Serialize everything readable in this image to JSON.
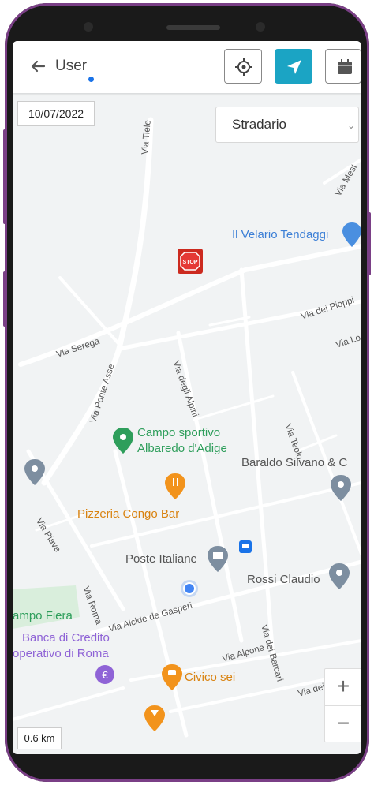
{
  "appbar": {
    "title": "User"
  },
  "map": {
    "date": "10/07/2022",
    "layer_select": "Stradario",
    "scale": "0.6 km",
    "zoom_in": "+",
    "zoom_out": "−",
    "pois": {
      "velario": "Il Velario Tendaggi",
      "campo_1": "Campo sportivo",
      "campo_2": "Albaredo d'Adige",
      "baraldo": "Baraldo Silvano & C",
      "pizzeria": "Pizzeria Congo Bar",
      "poste": "Poste Italiane",
      "rossi": "Rossi Claudio",
      "fiera": "ampo Fiera",
      "banca_1": "Banca di Credito",
      "banca_2": "operativo di Roma",
      "civico": "Civico sei"
    },
    "streets": {
      "tiele": "Via Tiele",
      "mest": "Via Mest",
      "pioppi": "Via dei Pioppi",
      "lo": "Via Lo",
      "serega": "Via Serega",
      "ponte_asse": "Via Ponte Asse",
      "alpini": "Via degli Alpini",
      "teolo": "Via Teolo",
      "piave": "Via Piave",
      "roma": "Via Roma",
      "gasperi": "Via Alcide de Gasperi",
      "barcari": "Via dei Barcari",
      "alpone": "Via Alpone",
      "dei": "Via dei D"
    }
  }
}
